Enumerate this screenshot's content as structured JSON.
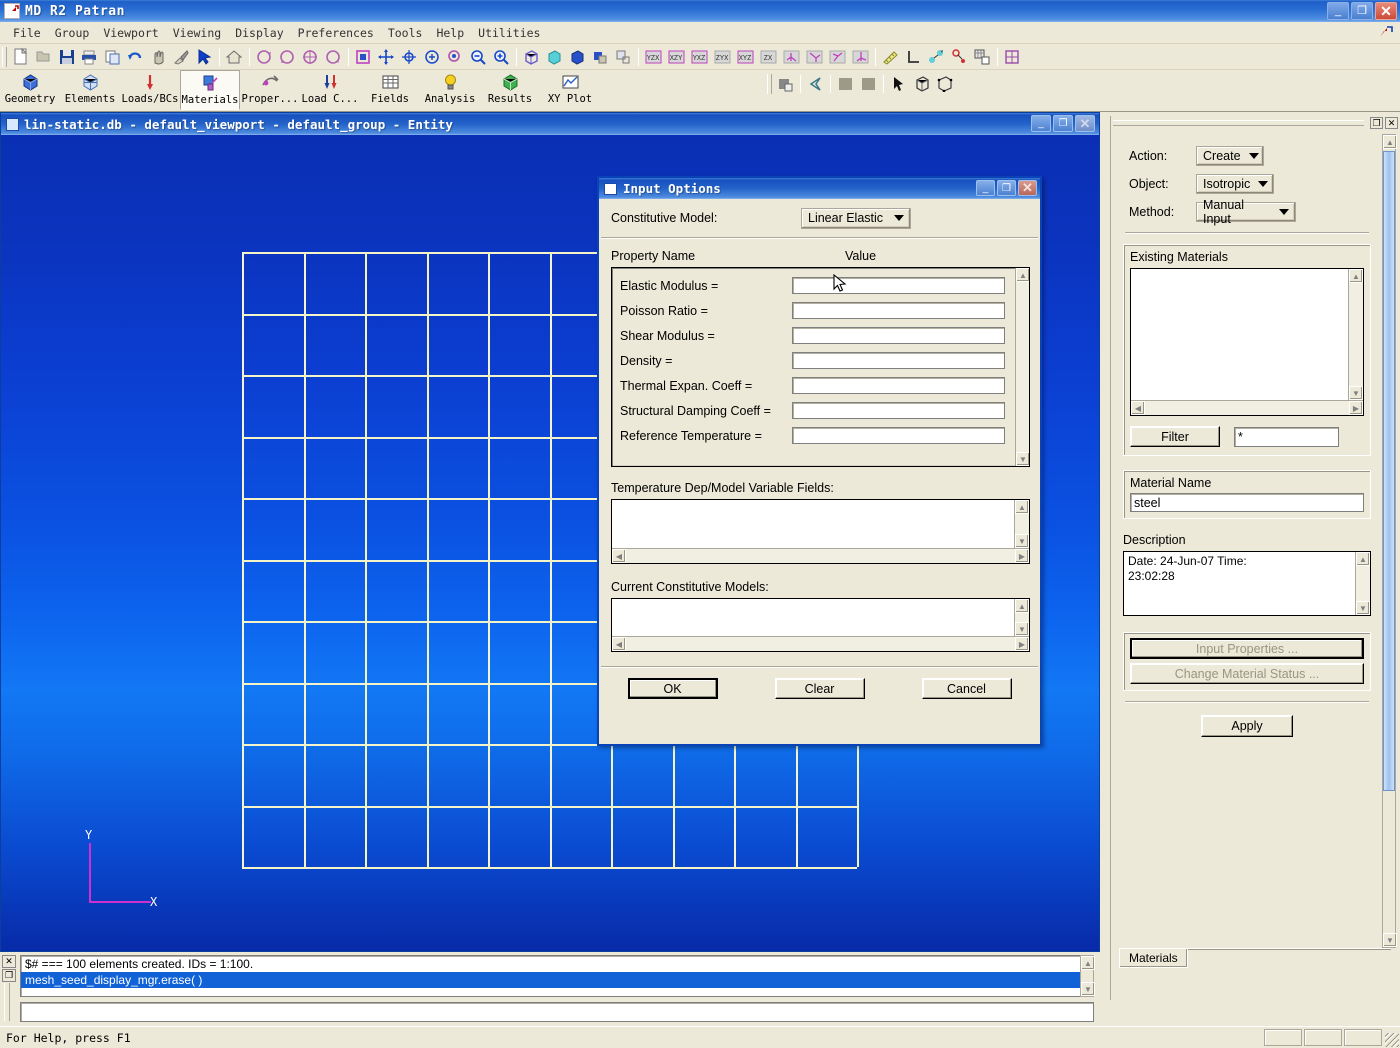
{
  "app": {
    "title": "MD R2 Patran",
    "logo_icon": "patran-logo-icon",
    "window_buttons": {
      "minimize": "_",
      "maximize": "❐",
      "close": "✕"
    }
  },
  "menubar": {
    "items": [
      {
        "label": "File"
      },
      {
        "label": "Group"
      },
      {
        "label": "Viewport"
      },
      {
        "label": "Viewing"
      },
      {
        "label": "Display"
      },
      {
        "label": "Preferences"
      },
      {
        "label": "Tools"
      },
      {
        "label": "Help"
      },
      {
        "label": "Utilities"
      }
    ]
  },
  "toolbar_modules": [
    {
      "label": "Geometry",
      "icon": "geometry-cube-icon",
      "selected": false
    },
    {
      "label": "Elements",
      "icon": "elements-mesh-icon",
      "selected": false
    },
    {
      "label": "Loads/BCs",
      "icon": "loads-arrow-icon",
      "selected": false
    },
    {
      "label": "Materials",
      "icon": "materials-icon",
      "selected": true
    },
    {
      "label": "Proper...",
      "icon": "properties-icon",
      "selected": false
    },
    {
      "label": "Load C...",
      "icon": "load-cases-icon",
      "selected": false
    },
    {
      "label": "Fields",
      "icon": "fields-table-icon",
      "selected": false
    },
    {
      "label": "Analysis",
      "icon": "analysis-bulb-icon",
      "selected": false
    },
    {
      "label": "Results",
      "icon": "results-globe-icon",
      "selected": false
    },
    {
      "label": "XY Plot",
      "icon": "xy-plot-icon",
      "selected": false
    }
  ],
  "viewport": {
    "title": "lin-static.db - default_viewport - default_group - Entity",
    "window_buttons": {
      "minimize": "_",
      "restore": "❐",
      "close": "✕"
    },
    "mesh": {
      "rows": 10,
      "cols": 10,
      "line_color": "#f4f4c8"
    },
    "triad": {
      "x_label": "X",
      "y_label": "Y",
      "color": "#d02fd0"
    },
    "background_colors": [
      "#0a2fb4",
      "#1278f4",
      "#072aa8"
    ]
  },
  "dialog": {
    "title": "Input Options",
    "window_buttons": {
      "minimize": "_",
      "maximize": "❐",
      "close": "✕"
    },
    "constitutive_model": {
      "label": "Constitutive Model:",
      "selected": "Linear Elastic"
    },
    "table_headers": {
      "name": "Property Name",
      "value": "Value"
    },
    "properties": [
      {
        "name": "Elastic Modulus =",
        "value": ""
      },
      {
        "name": "Poisson Ratio =",
        "value": ""
      },
      {
        "name": "Shear Modulus =",
        "value": ""
      },
      {
        "name": "Density =",
        "value": ""
      },
      {
        "name": "Thermal Expan. Coeff =",
        "value": ""
      },
      {
        "name": "Structural Damping Coeff =",
        "value": ""
      },
      {
        "name": "Reference Temperature =",
        "value": ""
      }
    ],
    "temp_fields_label": "Temperature Dep/Model Variable Fields:",
    "temp_fields_items": [],
    "current_models_label": "Current Constitutive Models:",
    "current_models_items": [],
    "buttons": {
      "ok": "OK",
      "clear": "Clear",
      "cancel": "Cancel"
    }
  },
  "right_panel": {
    "window_buttons": {
      "restore": "❐",
      "close": "✕"
    },
    "action": {
      "label": "Action:",
      "value": "Create"
    },
    "object": {
      "label": "Object:",
      "value": "Isotropic"
    },
    "method": {
      "label": "Method:",
      "value": "Manual Input"
    },
    "existing_materials": {
      "label": "Existing Materials",
      "items": []
    },
    "filter": {
      "button": "Filter",
      "value": "*"
    },
    "material_name": {
      "label": "Material Name",
      "value": "steel"
    },
    "description": {
      "label": "Description",
      "line1": "Date: 24-Jun-07          Time:",
      "line2": "23:02:28"
    },
    "input_properties_button": "Input Properties ...",
    "change_status_button": "Change Material Status ...",
    "apply_button": "Apply",
    "tab": "Materials"
  },
  "command_area": {
    "history": [
      {
        "text": "$# === 100 elements created.  IDs  = 1:100.",
        "selected": false
      },
      {
        "text": "mesh_seed_display_mgr.erase( )",
        "selected": true
      }
    ],
    "input_value": ""
  },
  "statusbar": {
    "help_text": "For Help, press F1",
    "cells": [
      "",
      "",
      ""
    ]
  }
}
